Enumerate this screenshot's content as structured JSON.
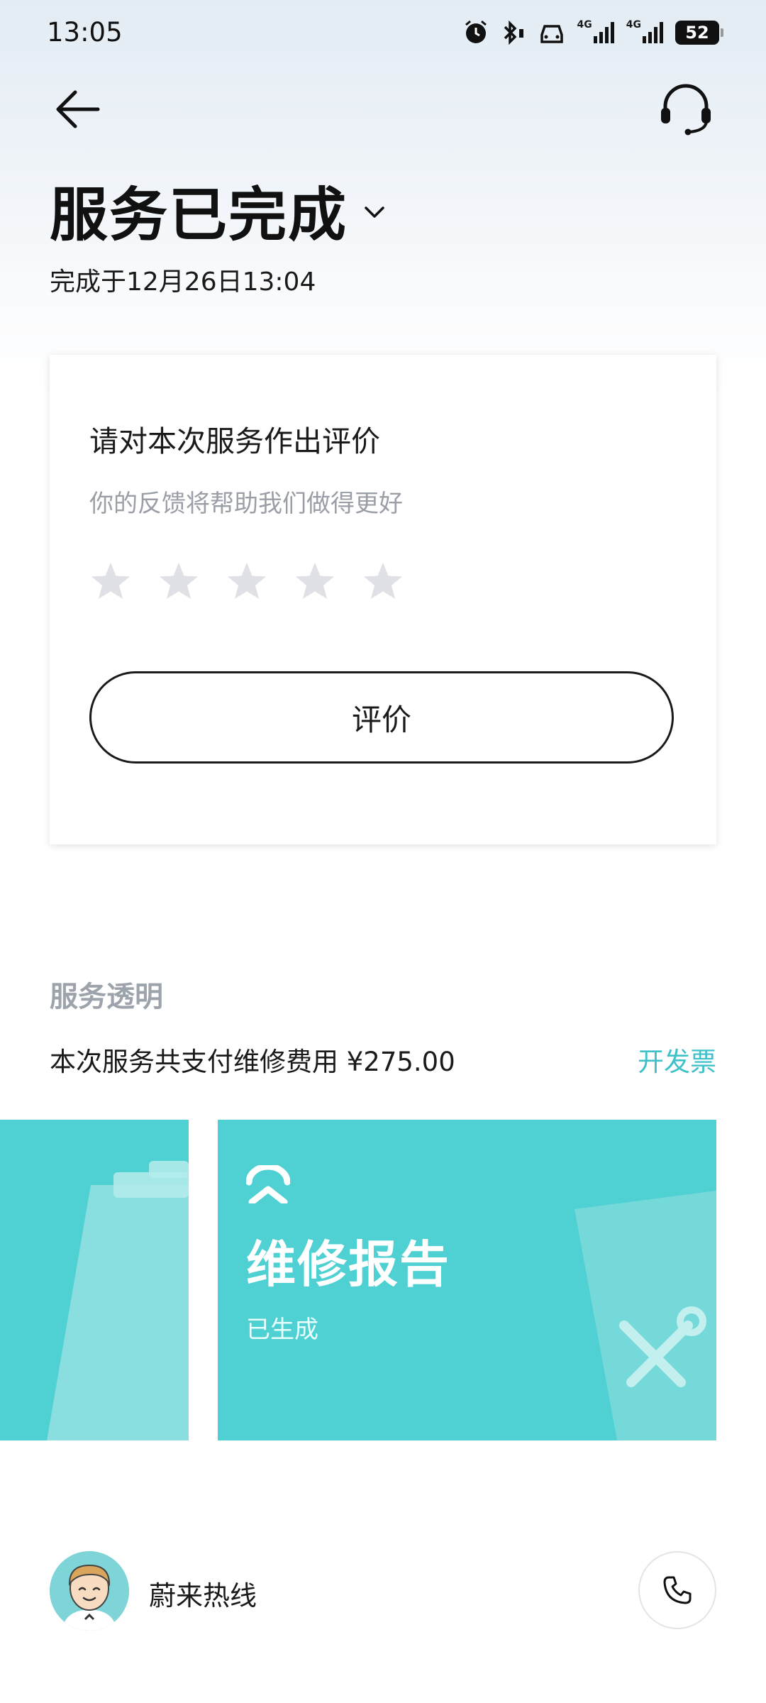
{
  "status_bar": {
    "time": "13:05",
    "network_1": "4G",
    "network_2": "4G",
    "battery": "52",
    "icons": [
      "alarm-icon",
      "bluetooth-icon",
      "car-icon",
      "signal-icon",
      "signal-icon",
      "battery-icon"
    ]
  },
  "nav": {
    "back_icon": "back-arrow-icon",
    "support_icon": "headset-icon"
  },
  "header": {
    "title": "服务已完成",
    "completed_at": "完成于12月26日13:04"
  },
  "rating_card": {
    "title": "请对本次服务作出评价",
    "subtitle": "你的反馈将帮助我们做得更好",
    "stars_total": 5,
    "stars_selected": 0,
    "button_label": "评价"
  },
  "transparency": {
    "section_label": "服务透明",
    "payment_text": "本次服务共支付维修费用 ¥275.00",
    "invoice_link": "开发票"
  },
  "report_card": {
    "title": "维修报告",
    "status": "已生成"
  },
  "hotline": {
    "label": "蔚来热线",
    "call_icon": "phone-icon"
  },
  "colors": {
    "accent": "#3ec1c8",
    "card_teal": "#4fd0d2",
    "star_inactive": "#dfe1e6",
    "muted_text": "#9da3ab"
  }
}
